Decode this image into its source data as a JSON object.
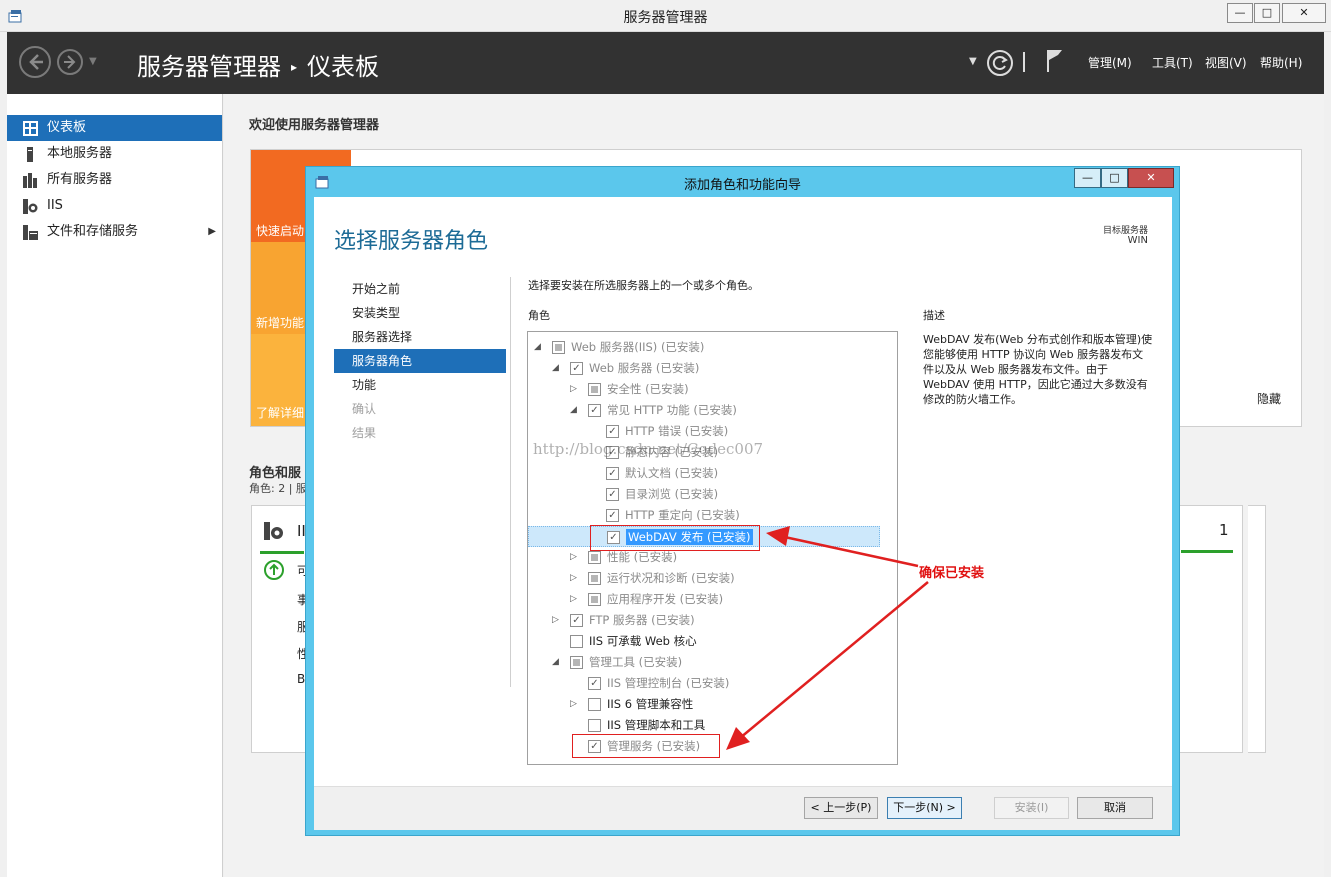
{
  "window": {
    "title": "服务器管理器",
    "min": "—",
    "max": "□",
    "close": "✕"
  },
  "header": {
    "breadcrumb_root": "服务器管理器",
    "breadcrumb_sep": "▸",
    "breadcrumb_page": "仪表板",
    "menus": [
      "管理(M)",
      "工具(T)",
      "视图(V)",
      "帮助(H)"
    ]
  },
  "sidebar": {
    "items": [
      {
        "label": "仪表板",
        "icon": "dashboard-icon"
      },
      {
        "label": "本地服务器",
        "icon": "server-icon"
      },
      {
        "label": "所有服务器",
        "icon": "servers-icon"
      },
      {
        "label": "IIS",
        "icon": "iis-icon"
      },
      {
        "label": "文件和存储服务",
        "icon": "storage-icon",
        "chevron": "▶"
      }
    ]
  },
  "dashboard": {
    "welcome": "欢迎使用服务器管理器",
    "tiles": [
      "快速启动",
      "新增功能",
      "了解详细"
    ],
    "roles_heading": "角色和服",
    "roles_sub": "角色: 2 | 服",
    "card_title": "II",
    "card_lines": [
      "可",
      "事",
      "服",
      "性",
      "B"
    ],
    "count": "1"
  },
  "wizard": {
    "title": "添加角色和功能向导",
    "heading": "选择服务器角色",
    "target_label": "目标服务器",
    "target_server": "WIN",
    "steps": [
      {
        "label": "开始之前",
        "state": "normal"
      },
      {
        "label": "安装类型",
        "state": "normal"
      },
      {
        "label": "服务器选择",
        "state": "normal"
      },
      {
        "label": "服务器角色",
        "state": "active"
      },
      {
        "label": "功能",
        "state": "normal"
      },
      {
        "label": "确认",
        "state": "disabled"
      },
      {
        "label": "结果",
        "state": "disabled"
      }
    ],
    "instruction": "选择要安装在所选服务器上的一个或多个角色。",
    "roles_label": "角色",
    "description_label": "描述",
    "description": "WebDAV 发布(Web 分布式创作和版本管理)使您能够使用 HTTP 协议向 Web 服务器发布文件以及从 Web 服务器发布文件。由于 WebDAV 使用 HTTP，因此它通过大多数没有修改的防火墙工作。",
    "hide": "隐藏",
    "tree": [
      {
        "label": "Web 服务器(IIS) (已安装)",
        "indent": 0,
        "exp": "◢",
        "check": "partial",
        "gray": true
      },
      {
        "label": "Web 服务器 (已安装)",
        "indent": 1,
        "exp": "◢",
        "check": "✓",
        "gray": true
      },
      {
        "label": "安全性 (已安装)",
        "indent": 2,
        "exp": "▷",
        "check": "partial",
        "gray": true
      },
      {
        "label": "常见 HTTP 功能 (已安装)",
        "indent": 2,
        "exp": "◢",
        "check": "✓",
        "gray": true
      },
      {
        "label": "HTTP 错误 (已安装)",
        "indent": 3,
        "exp": "",
        "check": "✓",
        "gray": true
      },
      {
        "label": "静态内容 (已安装)",
        "indent": 3,
        "exp": "",
        "check": "✓",
        "gray": true
      },
      {
        "label": "默认文档 (已安装)",
        "indent": 3,
        "exp": "",
        "check": "✓",
        "gray": true
      },
      {
        "label": "目录浏览 (已安装)",
        "indent": 3,
        "exp": "",
        "check": "✓",
        "gray": true
      },
      {
        "label": "HTTP 重定向 (已安装)",
        "indent": 3,
        "exp": "",
        "check": "✓",
        "gray": true
      },
      {
        "label": "WebDAV 发布 (已安装)",
        "indent": 3,
        "exp": "",
        "check": "✓",
        "gray": true,
        "selected": true
      },
      {
        "label": "性能 (已安装)",
        "indent": 2,
        "exp": "▷",
        "check": "partial",
        "gray": true
      },
      {
        "label": "运行状况和诊断 (已安装)",
        "indent": 2,
        "exp": "▷",
        "check": "partial",
        "gray": true
      },
      {
        "label": "应用程序开发 (已安装)",
        "indent": 2,
        "exp": "▷",
        "check": "partial",
        "gray": true
      },
      {
        "label": "FTP 服务器 (已安装)",
        "indent": 1,
        "exp": "▷",
        "check": "✓",
        "gray": true
      },
      {
        "label": "IIS 可承载 Web 核心",
        "indent": 1,
        "exp": "",
        "check": "",
        "gray": false
      },
      {
        "label": "管理工具 (已安装)",
        "indent": 1,
        "exp": "◢",
        "check": "partial",
        "gray": true
      },
      {
        "label": "IIS 管理控制台 (已安装)",
        "indent": 2,
        "exp": "",
        "check": "✓",
        "gray": true
      },
      {
        "label": "IIS 6 管理兼容性",
        "indent": 2,
        "exp": "▷",
        "check": "",
        "gray": false
      },
      {
        "label": "IIS 管理脚本和工具",
        "indent": 2,
        "exp": "",
        "check": "",
        "gray": false
      },
      {
        "label": "管理服务 (已安装)",
        "indent": 2,
        "exp": "",
        "check": "✓",
        "gray": true
      }
    ],
    "watermark": "http://blog.csdn.net/Codec007",
    "buttons": {
      "prev": "< 上一步(P)",
      "next": "下一步(N) >",
      "install": "安装(I)",
      "cancel": "取消"
    }
  },
  "annotation": {
    "text": "确保已安装",
    "color": "#e02020"
  }
}
